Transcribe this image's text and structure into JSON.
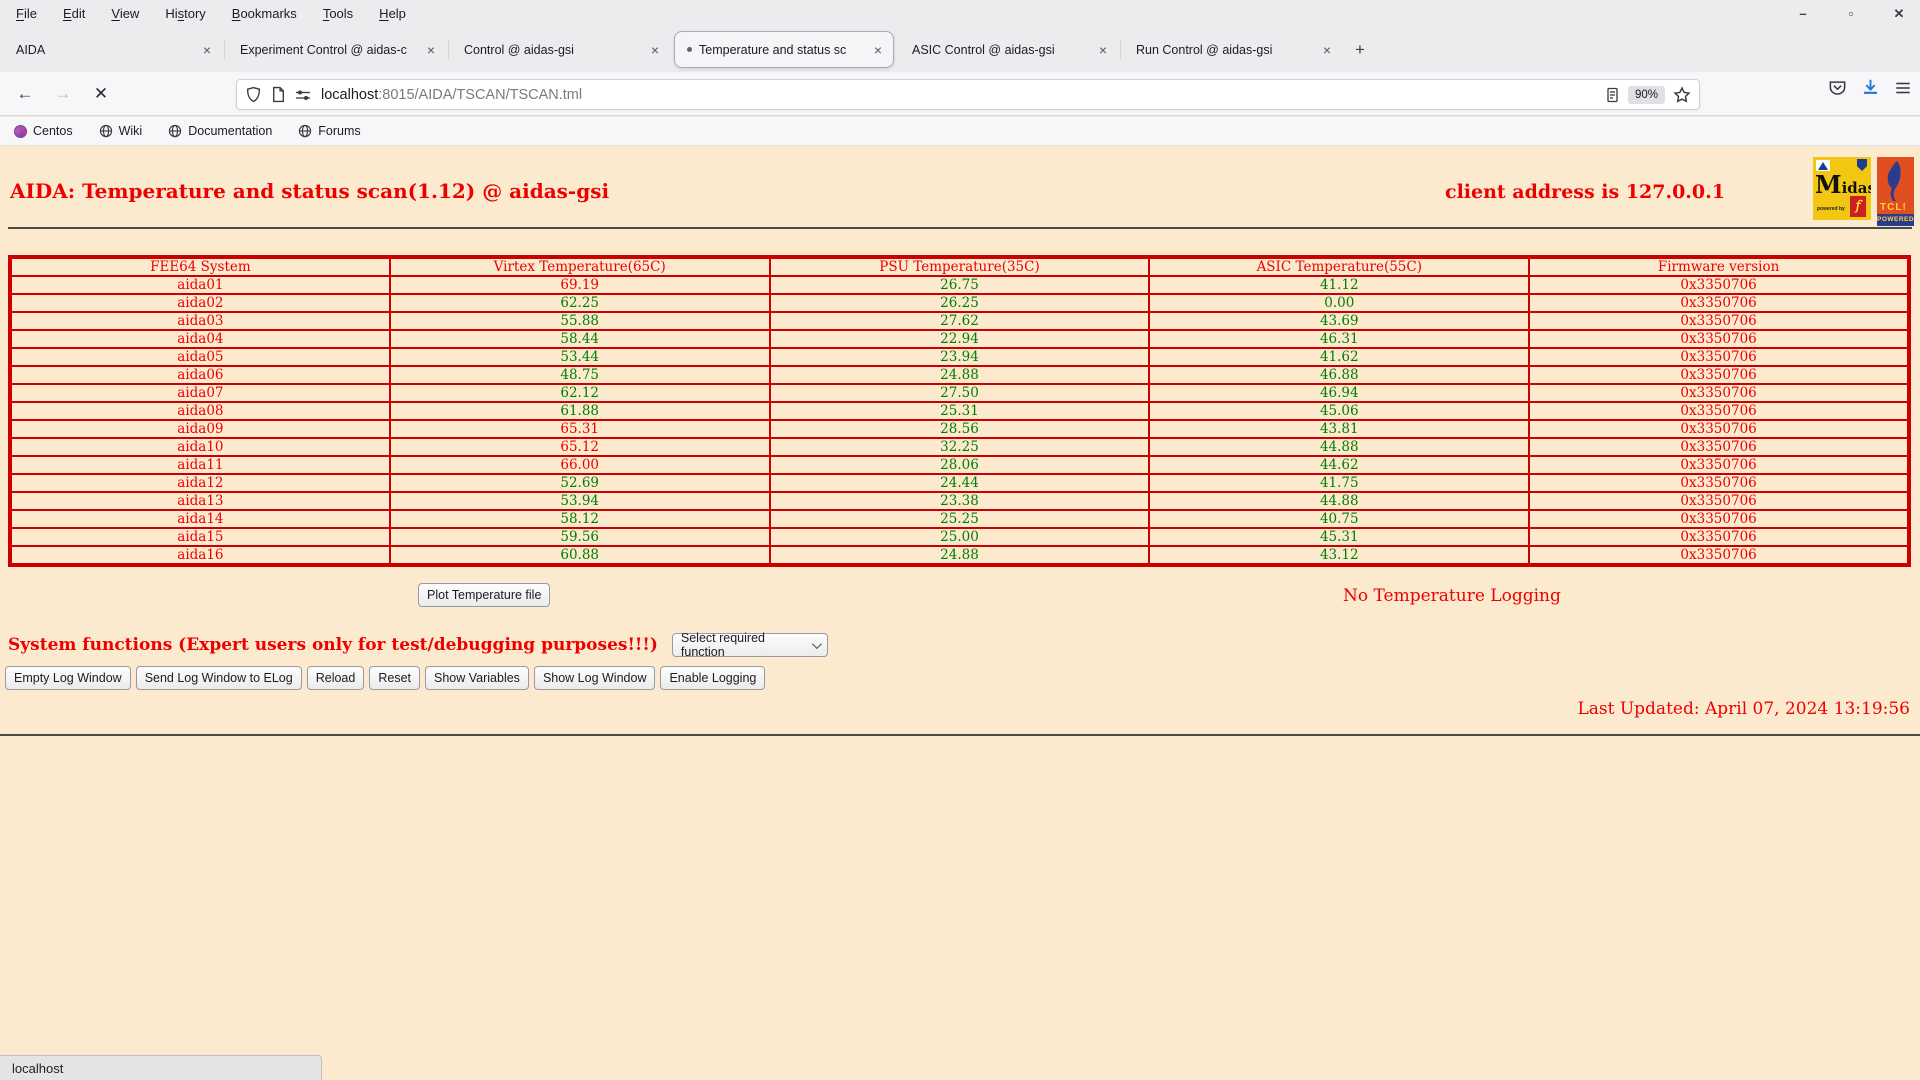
{
  "colors": {
    "page_bg": "#fceacf",
    "accent_red": "#ee0000",
    "value_green": "#008000",
    "table_border_red": "#cc0000"
  },
  "browser": {
    "menu": [
      {
        "label": "File",
        "accel": 0
      },
      {
        "label": "Edit",
        "accel": 0
      },
      {
        "label": "View",
        "accel": 0
      },
      {
        "label": "History",
        "accel": 2
      },
      {
        "label": "Bookmarks",
        "accel": 0
      },
      {
        "label": "Tools",
        "accel": 0
      },
      {
        "label": "Help",
        "accel": 0
      }
    ],
    "window_controls": {
      "minimize": "–",
      "maximize": "▫",
      "close": "✕"
    },
    "tabs": [
      {
        "title": "AIDA",
        "active": false,
        "dot": false
      },
      {
        "title": "Experiment Control @ aidas-c",
        "active": false,
        "dot": false
      },
      {
        "title": "Control @ aidas-gsi",
        "active": false,
        "dot": false
      },
      {
        "title": "Temperature and status sc",
        "active": true,
        "dot": true
      },
      {
        "title": "ASIC Control @ aidas-gsi",
        "active": false,
        "dot": false
      },
      {
        "title": "Run Control @ aidas-gsi",
        "active": false,
        "dot": false
      }
    ],
    "newtab_label": "+",
    "url": {
      "host": "localhost",
      "rest": ":8015/AIDA/TSCAN/TSCAN.tml"
    },
    "zoom_badge": "90%",
    "bookmarks": [
      {
        "label": "Centos",
        "icon": "centos"
      },
      {
        "label": "Wiki",
        "icon": "globe"
      },
      {
        "label": "Documentation",
        "icon": "globe"
      },
      {
        "label": "Forums",
        "icon": "globe"
      }
    ],
    "status_text": "localhost"
  },
  "page": {
    "title": "AIDA: Temperature and status scan(1.12) @ aidas-gsi",
    "client_address": "client address is 127.0.0.1",
    "table": {
      "columns": [
        "FEE64 System",
        "Virtex Temperature(65C)",
        "PSU Temperature(35C)",
        "ASIC Temperature(55C)",
        "Firmware version"
      ],
      "rows": [
        {
          "system": "aida01",
          "virtex": "69.19",
          "virtex_alarm": true,
          "psu": "26.75",
          "asic": "41.12",
          "firmware": "0x3350706"
        },
        {
          "system": "aida02",
          "virtex": "62.25",
          "virtex_alarm": false,
          "psu": "26.25",
          "asic": "0.00",
          "firmware": "0x3350706"
        },
        {
          "system": "aida03",
          "virtex": "55.88",
          "virtex_alarm": false,
          "psu": "27.62",
          "asic": "43.69",
          "firmware": "0x3350706"
        },
        {
          "system": "aida04",
          "virtex": "58.44",
          "virtex_alarm": false,
          "psu": "22.94",
          "asic": "46.31",
          "firmware": "0x3350706"
        },
        {
          "system": "aida05",
          "virtex": "53.44",
          "virtex_alarm": false,
          "psu": "23.94",
          "asic": "41.62",
          "firmware": "0x3350706"
        },
        {
          "system": "aida06",
          "virtex": "48.75",
          "virtex_alarm": false,
          "psu": "24.88",
          "asic": "46.88",
          "firmware": "0x3350706"
        },
        {
          "system": "aida07",
          "virtex": "62.12",
          "virtex_alarm": false,
          "psu": "27.50",
          "asic": "46.94",
          "firmware": "0x3350706"
        },
        {
          "system": "aida08",
          "virtex": "61.88",
          "virtex_alarm": false,
          "psu": "25.31",
          "asic": "45.06",
          "firmware": "0x3350706"
        },
        {
          "system": "aida09",
          "virtex": "65.31",
          "virtex_alarm": true,
          "psu": "28.56",
          "asic": "43.81",
          "firmware": "0x3350706"
        },
        {
          "system": "aida10",
          "virtex": "65.12",
          "virtex_alarm": true,
          "psu": "32.25",
          "asic": "44.88",
          "firmware": "0x3350706"
        },
        {
          "system": "aida11",
          "virtex": "66.00",
          "virtex_alarm": true,
          "psu": "28.06",
          "asic": "44.62",
          "firmware": "0x3350706"
        },
        {
          "system": "aida12",
          "virtex": "52.69",
          "virtex_alarm": false,
          "psu": "24.44",
          "asic": "41.75",
          "firmware": "0x3350706"
        },
        {
          "system": "aida13",
          "virtex": "53.94",
          "virtex_alarm": false,
          "psu": "23.38",
          "asic": "44.88",
          "firmware": "0x3350706"
        },
        {
          "system": "aida14",
          "virtex": "58.12",
          "virtex_alarm": false,
          "psu": "25.25",
          "asic": "40.75",
          "firmware": "0x3350706"
        },
        {
          "system": "aida15",
          "virtex": "59.56",
          "virtex_alarm": false,
          "psu": "25.00",
          "asic": "45.31",
          "firmware": "0x3350706"
        },
        {
          "system": "aida16",
          "virtex": "60.88",
          "virtex_alarm": false,
          "psu": "24.88",
          "asic": "43.12",
          "firmware": "0x3350706"
        }
      ]
    },
    "plot_button_label": "Plot Temperature file",
    "no_logging_label": "No Temperature Logging",
    "system_functions_label": "System functions (Expert users only for test/debugging purposes!!!)",
    "select_value": "Select required function",
    "system_buttons": [
      "Empty Log Window",
      "Send Log Window to ELog",
      "Reload",
      "Reset",
      "Show Variables",
      "Show Log Window",
      "Enable Logging"
    ],
    "last_updated": "Last Updated: April 07, 2024 13:19:56",
    "logos": {
      "midas_initial": "M",
      "midas_rest": "idas",
      "midas_powered_by": "powered by",
      "tcl_word": "TCL!",
      "tcl_band": "POWERED"
    }
  }
}
